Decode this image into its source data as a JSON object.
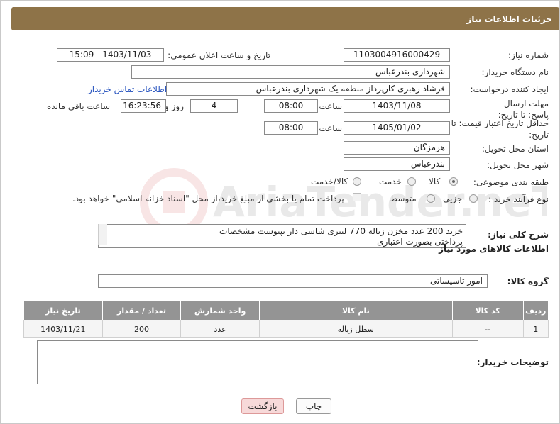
{
  "header": {
    "title": "جزئیات اطلاعات نیاز"
  },
  "fields": {
    "need_number_label": "شماره نیاز:",
    "need_number": "1103004916000429",
    "announce_label": "تاریخ و ساعت اعلان عمومی:",
    "announce_value": "1403/11/03 - 15:09",
    "buyer_org_label": "نام دستگاه خریدار:",
    "buyer_org": "شهرداری بندرعباس",
    "creator_label": "ایجاد کننده درخواست:",
    "creator": "فرشاد رهبری کارپرداز منطقه یک شهرداری بندرعباس",
    "contact_link": "اطلاعات تماس خریدار",
    "deadline_label": "مهلت ارسال پاسخ: تا تاریخ:",
    "deadline_date": "1403/11/08",
    "time_label": "ساعت",
    "deadline_time": "08:00",
    "days_value": "4",
    "days_label": "روز و",
    "remaining_time": "16:23:56",
    "remaining_label": "ساعت باقی مانده",
    "price_valid_label": "حداقل تاریخ اعتبار قیمت: تا تاریخ:",
    "price_valid_date": "1405/01/02",
    "price_valid_time": "08:00",
    "province_label": "استان محل تحویل:",
    "province": "هرمزگان",
    "city_label": "شهر محل تحویل:",
    "city": "بندرعباس",
    "category_label": "طبقه بندی موضوعی:",
    "category_options": [
      "کالا",
      "خدمت",
      "کالا/خدمت"
    ],
    "process_label": "نوع فرآیند خرید :",
    "process_options": [
      "جزیی",
      "متوسط"
    ],
    "payment_note": "پرداخت تمام یا بخشی از مبلغ خرید،از محل \"اسناد خزانه اسلامی\" خواهد بود."
  },
  "description": {
    "label": "شرح کلی نیاز:",
    "line1": "خرید 200 عدد  مخزن زباله 770 لیتری شاسی دار بپیوست مشخصات",
    "line2": "پرداختی بصورت اعتباری"
  },
  "goods": {
    "section_title": "اطلاعات کالاهای مورد نیاز",
    "group_label": "گروه کالا:",
    "group_value": "امور تاسیساتی",
    "columns": [
      "ردیف",
      "کد کالا",
      "نام کالا",
      "واحد شمارش",
      "تعداد / مقدار",
      "تاریخ نیاز"
    ],
    "rows": [
      [
        "1",
        "--",
        "سطل زباله",
        "عدد",
        "200",
        "1403/11/21"
      ]
    ]
  },
  "buyer_notes": {
    "label": "توضیحات خریدار:",
    "value": ""
  },
  "buttons": {
    "print": "چاپ",
    "back": "بازگشت"
  },
  "watermark_text": "AriaTender.neT",
  "colors": {
    "header": "#8e7348",
    "table_header": "#949494",
    "link": "#2d58c0",
    "back_button": "#f7d9d9"
  }
}
